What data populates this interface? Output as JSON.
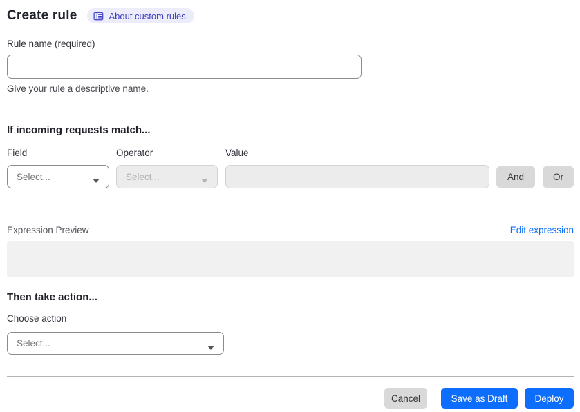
{
  "header": {
    "title": "Create rule",
    "about_badge_label": "About custom rules"
  },
  "rule_name": {
    "label": "Rule name (required)",
    "value": "",
    "helper": "Give your rule a descriptive name."
  },
  "match_section": {
    "heading": "If incoming requests match...",
    "field": {
      "label": "Field",
      "placeholder": "Select..."
    },
    "operator": {
      "label": "Operator",
      "placeholder": "Select..."
    },
    "value": {
      "label": "Value",
      "value": ""
    },
    "and_button_label": "And",
    "or_button_label": "Or",
    "expression_preview_label": "Expression Preview",
    "edit_expression_label": "Edit expression",
    "expression_value": ""
  },
  "action_section": {
    "heading": "Then take action...",
    "choose_label": "Choose action",
    "placeholder": "Select..."
  },
  "footer": {
    "cancel_label": "Cancel",
    "save_draft_label": "Save as Draft",
    "deploy_label": "Deploy"
  },
  "colors": {
    "primary_blue": "#0d6efd",
    "link_blue": "#0b6dfb",
    "badge_background": "#ececfa",
    "badge_text": "#3d3fc1",
    "neutral_button": "#d9d9d9",
    "disabled_field_background": "#ececec",
    "expression_box_background": "#f1f1f2"
  }
}
